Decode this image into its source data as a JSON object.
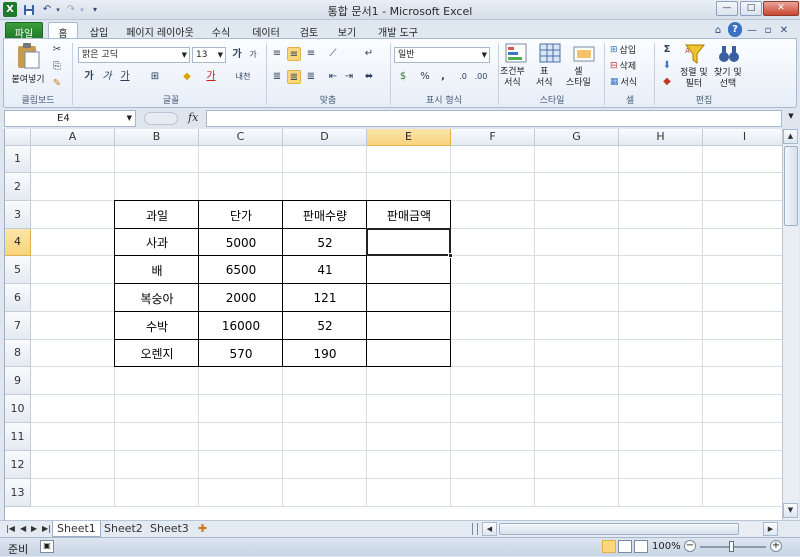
{
  "window": {
    "title": "통합 문서1 - Microsoft Excel",
    "controls": {
      "minimize": "—",
      "maximize": "□",
      "close": "✕"
    }
  },
  "quick_access": [
    "save-icon",
    "undo-icon",
    "redo-icon",
    "customize-icon"
  ],
  "tabs": [
    {
      "label": "파일"
    },
    {
      "label": "홈"
    },
    {
      "label": "삽입"
    },
    {
      "label": "페이지 레이아웃"
    },
    {
      "label": "수식"
    },
    {
      "label": "데이터"
    },
    {
      "label": "검토"
    },
    {
      "label": "보기"
    },
    {
      "label": "개발 도구"
    }
  ],
  "ribbon": {
    "clipboard": {
      "paste": "붙여넣기",
      "group": "클립보드"
    },
    "font": {
      "name": "맑은 고딕",
      "size": "13",
      "group": "글꼴",
      "bold": "가",
      "italic": "가",
      "underline": "가",
      "grow": "가",
      "shrink": "가",
      "color_char": "가",
      "phonetic": "내천"
    },
    "align": {
      "group": "맞춤"
    },
    "number": {
      "format": "일반",
      "group": "표시 형식",
      "percent": "%",
      "comma": ","
    },
    "styles": {
      "conditional": "조건부\n서식",
      "table": "표\n서식",
      "cell": "셀\n스타일",
      "group": "스타일"
    },
    "cells": {
      "insert": "삽입",
      "delete": "삭제",
      "format": "서식",
      "group": "셀"
    },
    "editing": {
      "sum": "Σ",
      "sort": "정렬 및\n필터",
      "find": "찾기 및\n선택",
      "group": "편집"
    }
  },
  "formula_bar": {
    "name_box": "E4",
    "fx": "fx",
    "value": ""
  },
  "columns": [
    "A",
    "B",
    "C",
    "D",
    "E",
    "F",
    "G",
    "H",
    "I"
  ],
  "rows": [
    "1",
    "2",
    "3",
    "4",
    "5",
    "6",
    "7",
    "8",
    "9",
    "10",
    "11",
    "12",
    "13"
  ],
  "active_cell": "E4",
  "table": {
    "headers": [
      "과일",
      "단가",
      "판매수량",
      "판매금액"
    ],
    "rows": [
      [
        "사과",
        "5000",
        "52",
        ""
      ],
      [
        "배",
        "6500",
        "41",
        ""
      ],
      [
        "복숭아",
        "2000",
        "121",
        ""
      ],
      [
        "수박",
        "16000",
        "52",
        ""
      ],
      [
        "오렌지",
        "570",
        "190",
        ""
      ]
    ]
  },
  "sheets": [
    "Sheet1",
    "Sheet2",
    "Sheet3"
  ],
  "status": {
    "ready": "준비",
    "zoom": "100%"
  }
}
